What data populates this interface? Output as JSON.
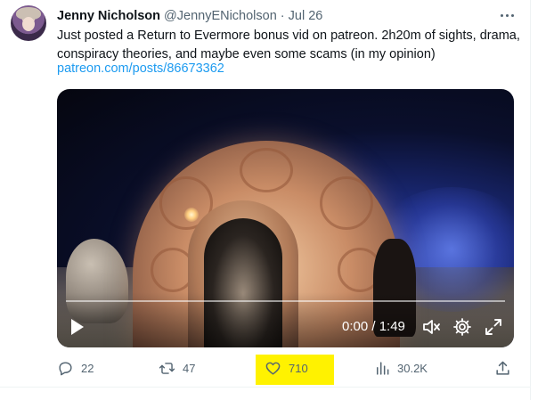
{
  "tweet": {
    "author_name": "Jenny Nicholson",
    "author_handle": "@JennyENicholson",
    "separator": "·",
    "date": "Jul 26",
    "text": "Just posted a Return to Evermore bonus vid on patreon. 2h20m of sights, drama, conspiracy theories, and maybe even some scams (in my opinion)",
    "link": "patreon.com/posts/86673362"
  },
  "video": {
    "elapsed": "0:00",
    "duration": "1:49",
    "time_display": "0:00 / 1:49",
    "progress_fraction": 0
  },
  "actions": {
    "replies": "22",
    "retweets": "47",
    "likes": "710",
    "views": "30.2K"
  },
  "icons": {
    "more": "more-horizontal-icon",
    "play": "play-icon",
    "mute": "speaker-muted-icon",
    "settings": "gear-icon",
    "fullscreen": "expand-icon",
    "reply": "reply-bubble-icon",
    "retweet": "retweet-icon",
    "like": "heart-icon",
    "views": "bar-chart-icon",
    "share": "share-upload-icon"
  },
  "colors": {
    "text": "#0f1419",
    "secondary": "#536471",
    "link": "#1d9bf0",
    "highlight": "#fff200"
  }
}
